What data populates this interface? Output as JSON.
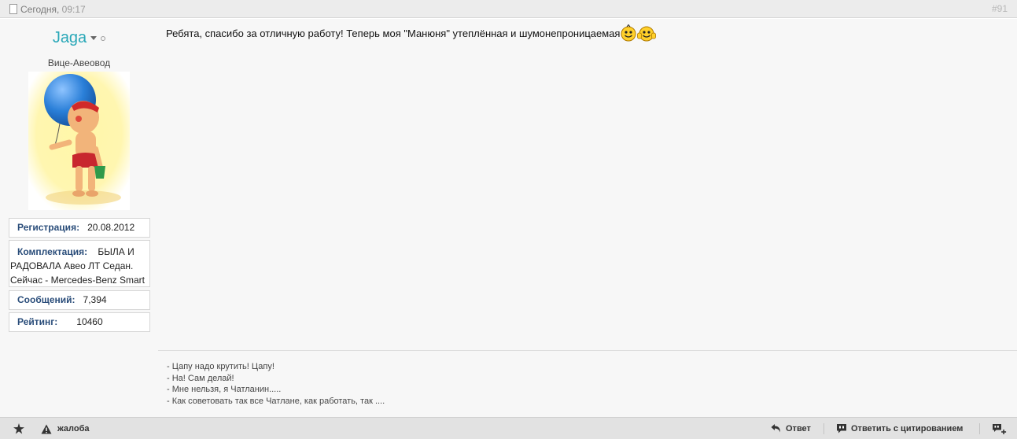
{
  "post": {
    "date_label": "Сегодня,",
    "time": "09:17",
    "number": "#91"
  },
  "user": {
    "name": "Jaga",
    "title": "Вице-Авеовод",
    "info": {
      "reg_label": "Регистрация:",
      "reg_value": "20.08.2012",
      "config_label": "Комплектация:",
      "config_value_1": "БЫЛА И",
      "config_value_2": "РАДОВАЛА Авео ЛТ Седан.",
      "config_value_3": "Сейчас - Mercedes-Benz Smart",
      "posts_label": "Сообщений:",
      "posts_value": "7,394",
      "rating_label": "Рейтинг:",
      "rating_value": "10460"
    }
  },
  "message": {
    "text": "Ребята, спасибо за отличную работу! Теперь моя \"Манюня\" утеплённая и шумонепроницаемая"
  },
  "signature": [
    "- Цапу надо крутить! Цапу!",
    "- На! Сам делай!",
    "- Мне нельзя, я Чатланин.....",
    "- Как советовать так все Чатлане, как работать, так ...."
  ],
  "footer": {
    "report_label": "жалоба",
    "reply_label": "Ответ",
    "quote_label": "Ответить с цитированием"
  },
  "icons": {
    "doc": "document-icon",
    "star": "star-icon",
    "warning": "warning-icon",
    "reply": "reply-arrow-icon",
    "quote": "quote-bubble-icon",
    "multiquote": "multiquote-plus-icon"
  },
  "colors": {
    "username": "#2aa8b8",
    "label": "#2a4d7a",
    "header_bg": "#ececec",
    "footer_bg": "#e2e2e2"
  }
}
